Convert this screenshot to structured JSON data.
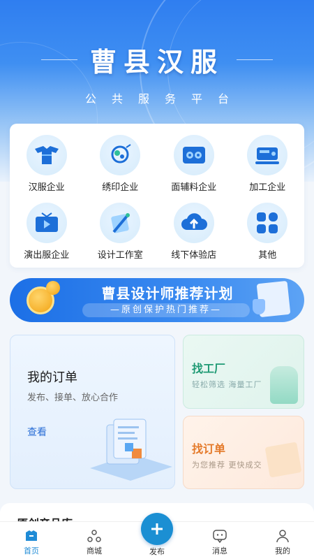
{
  "header": {
    "title": "曹县汉服",
    "subtitle": "公共服务平台"
  },
  "categories": [
    {
      "label": "汉服企业",
      "icon": "hanfu-icon"
    },
    {
      "label": "绣印企业",
      "icon": "embroidery-icon"
    },
    {
      "label": "面辅料企业",
      "icon": "fabric-icon"
    },
    {
      "label": "加工企业",
      "icon": "sewing-machine-icon"
    },
    {
      "label": "演出服企业",
      "icon": "tv-icon"
    },
    {
      "label": "设计工作室",
      "icon": "design-icon"
    },
    {
      "label": "线下体验店",
      "icon": "cloud-upload-icon"
    },
    {
      "label": "其他",
      "icon": "grid-icon"
    }
  ],
  "designer_banner": {
    "title": "曹县设计师推荐计划",
    "subtitle": "—原创保护热门推荐—"
  },
  "orders_card": {
    "title": "我的订单",
    "subtitle": "发布、接单、放心合作",
    "link": "查看"
  },
  "factory_card": {
    "title": "找工厂",
    "subtitle": "轻松筛选 海量工厂"
  },
  "findorder_card": {
    "title": "找订单",
    "subtitle": "为您推荐 更快成交"
  },
  "section_peek": {
    "title": "原创产品库"
  },
  "nav": {
    "home": "首页",
    "mall": "商城",
    "publish": "发布",
    "messages": "消息",
    "mine": "我的"
  },
  "colors": {
    "primary": "#1f8bd6",
    "factory_green": "#1f9a74",
    "order_orange": "#e47a2a"
  }
}
